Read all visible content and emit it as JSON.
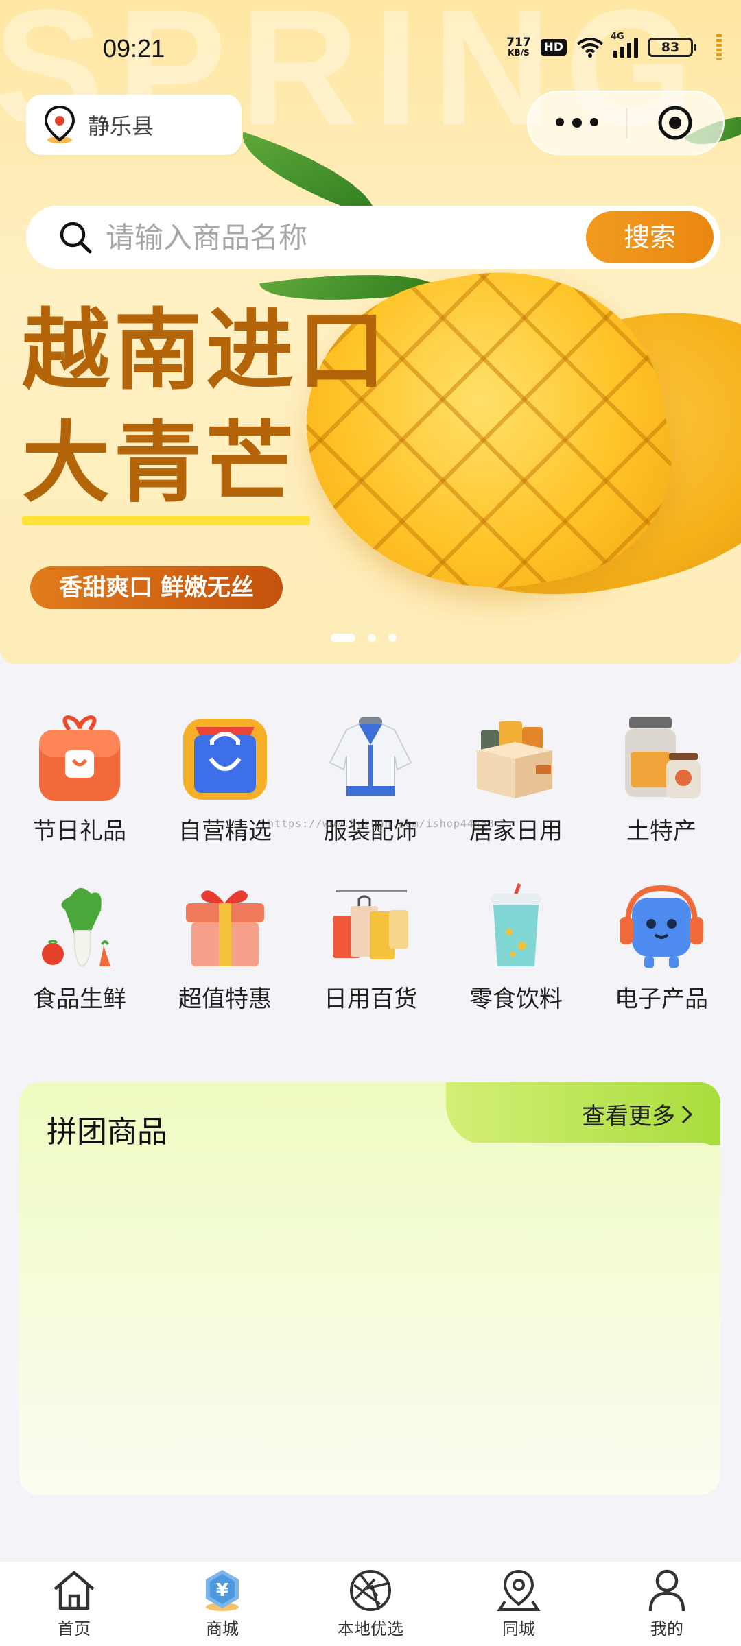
{
  "status_bar": {
    "time": "09:21",
    "speed_value": "717",
    "speed_unit": "KB/S",
    "hd": "HD",
    "network": "4G",
    "battery": "83"
  },
  "header": {
    "location": "静乐县",
    "search_placeholder": "请输入商品名称",
    "search_button": "搜索"
  },
  "banner": {
    "watermark": "SPRING",
    "title_line1": "越南进口",
    "title_line2": "大青芒",
    "tagline": "香甜爽口 鲜嫩无丝",
    "slides": 3,
    "active_slide": 1
  },
  "categories": [
    {
      "label": "节日礼品",
      "icon": "gift-box-icon"
    },
    {
      "label": "自营精选",
      "icon": "shopping-bag-icon"
    },
    {
      "label": "服装配饰",
      "icon": "jacket-icon"
    },
    {
      "label": "居家日用",
      "icon": "storage-box-icon"
    },
    {
      "label": "土特产",
      "icon": "jar-icon"
    },
    {
      "label": "食品生鲜",
      "icon": "vegetable-icon"
    },
    {
      "label": "超值特惠",
      "icon": "present-icon"
    },
    {
      "label": "日用百货",
      "icon": "shopping-bags-rack-icon"
    },
    {
      "label": "零食饮料",
      "icon": "drink-cup-icon"
    },
    {
      "label": "电子产品",
      "icon": "robot-headphone-icon"
    }
  ],
  "watermark_url": "https://www.huzhan.com/ishop44453",
  "group_buy": {
    "title": "拼团商品",
    "more": "查看更多"
  },
  "tabbar": [
    {
      "label": "首页",
      "icon": "home-icon"
    },
    {
      "label": "商城",
      "icon": "mall-yen-icon",
      "active": true
    },
    {
      "label": "本地优选",
      "icon": "aperture-icon"
    },
    {
      "label": "同城",
      "icon": "map-pin-icon"
    },
    {
      "label": "我的",
      "icon": "user-icon"
    }
  ],
  "colors": {
    "accent": "#ee8f17",
    "banner_title": "#b4650a",
    "tab_active": "#3a8fd8"
  }
}
